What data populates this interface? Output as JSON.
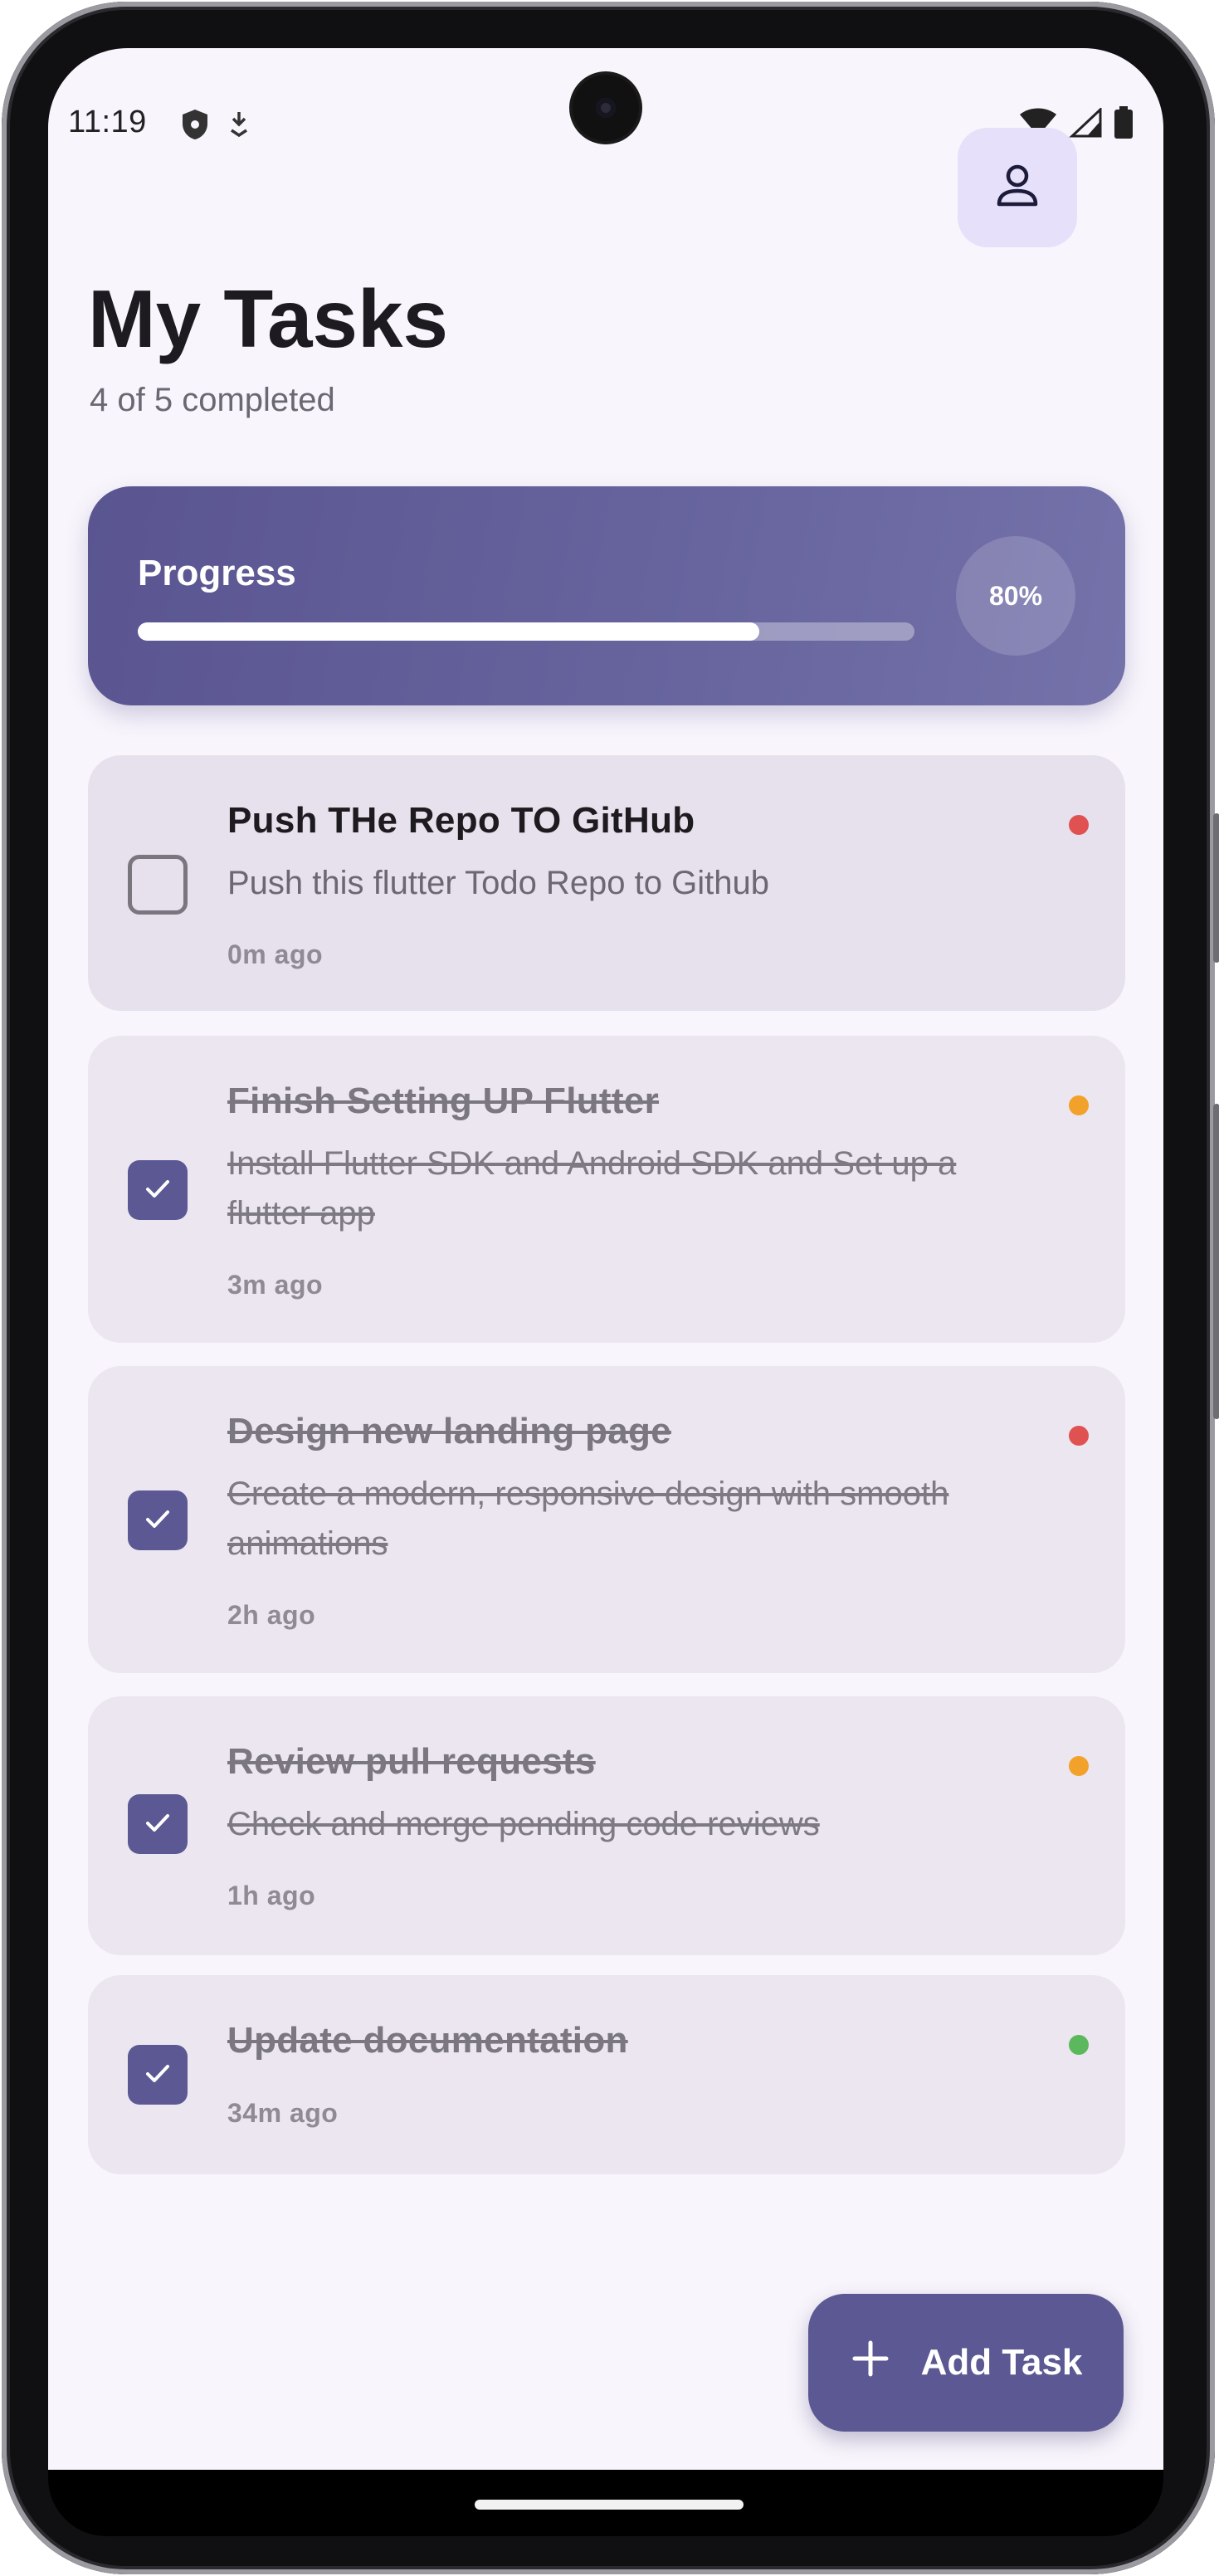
{
  "status_bar": {
    "time": "11:19",
    "icons_left": [
      "shield-icon",
      "download-icon"
    ],
    "icons_right": [
      "wifi-icon",
      "signal-icon",
      "battery-icon"
    ]
  },
  "header": {
    "title": "My Tasks",
    "subtitle": "4 of 5 completed",
    "profile_icon": "person-icon"
  },
  "progress": {
    "label": "Progress",
    "percent_text": "80%",
    "fraction": 0.8
  },
  "tasks": [
    {
      "title": "Push THe Repo TO GitHub",
      "description": "Push this flutter Todo Repo to Github",
      "time": "0m ago",
      "completed": false,
      "priority_color": "#e05252"
    },
    {
      "title": "Finish Setting UP Flutter",
      "description": "Install Flutter SDK and Android SDK and Set up a flutter app",
      "time": "3m ago",
      "completed": true,
      "priority_color": "#f2a12b"
    },
    {
      "title": "Design new landing page",
      "description": "Create a modern, responsive design with smooth animations",
      "time": "2h ago",
      "completed": true,
      "priority_color": "#e05252"
    },
    {
      "title": "Review pull requests",
      "description": "Check and merge pending code reviews",
      "time": "1h ago",
      "completed": true,
      "priority_color": "#f2a12b"
    },
    {
      "title": "Update documentation",
      "description": "",
      "time": "34m ago",
      "completed": true,
      "priority_color": "#5cb85c"
    }
  ],
  "fab": {
    "label": "Add Task",
    "icon": "plus-icon"
  },
  "colors": {
    "accent": "#5c5893",
    "background": "#f8f5fc",
    "card": "#e6e1ec"
  }
}
